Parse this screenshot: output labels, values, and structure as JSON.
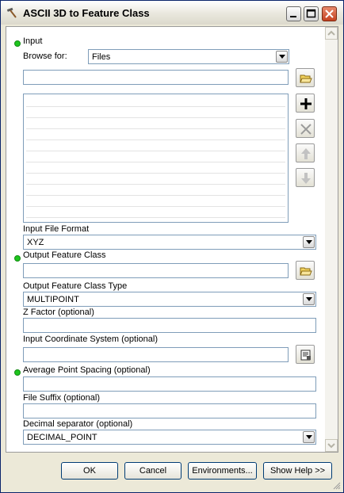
{
  "window": {
    "title": "ASCII 3D to Feature Class"
  },
  "input": {
    "label": "Input",
    "browse_label": "Browse for:",
    "browse_value": "Files",
    "path_value": ""
  },
  "input_file_format": {
    "label": "Input File Format",
    "value": "XYZ"
  },
  "output_feature_class": {
    "label": "Output Feature Class",
    "value": ""
  },
  "output_feature_class_type": {
    "label": "Output Feature Class Type",
    "value": "MULTIPOINT"
  },
  "z_factor": {
    "label": "Z Factor (optional)",
    "value": ""
  },
  "input_coordinate_system": {
    "label": "Input Coordinate System (optional)",
    "value": ""
  },
  "average_point_spacing": {
    "label": "Average Point Spacing (optional)",
    "value": ""
  },
  "file_suffix": {
    "label": "File Suffix (optional)",
    "value": ""
  },
  "decimal_separator": {
    "label": "Decimal separator (optional)",
    "value": "DECIMAL_POINT"
  },
  "buttons": {
    "ok": "OK",
    "cancel": "Cancel",
    "environments": "Environments...",
    "show_help": "Show Help >>"
  },
  "icons": {
    "title": "hammer-icon",
    "browse": "open-folder-icon",
    "add": "plus-icon",
    "remove": "x-icon",
    "up": "arrow-up-icon",
    "down": "arrow-down-icon",
    "coordinate": "properties-icon",
    "required": "green-dot-icon"
  },
  "colors": {
    "required_indicator": "#1ec51e",
    "close_button": "#c4411f"
  }
}
